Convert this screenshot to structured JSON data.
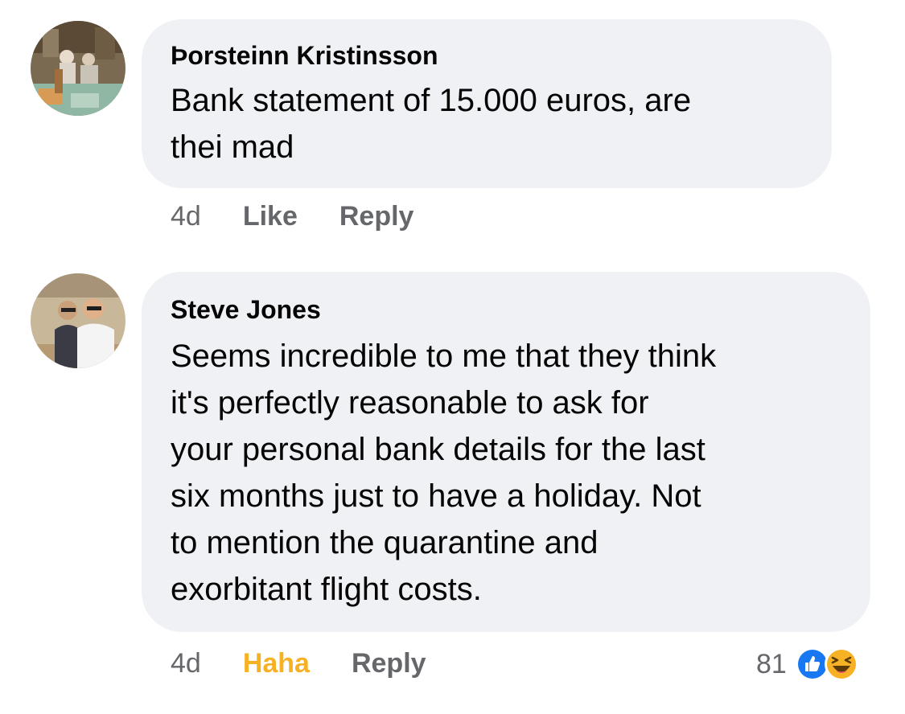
{
  "comments": [
    {
      "author": "Þorsteinn Kristinsson",
      "text": "Bank statement of 15.000 euros, are thei mad",
      "lines": [
        "Bank statement of 15.000 euros, are",
        "thei mad"
      ],
      "time": "4d",
      "like_label": "Like",
      "reply_label": "Reply"
    },
    {
      "author": "Steve Jones",
      "text": "Seems incredible to me that they think it's perfectly reasonable to ask for your personal bank details for the last six months just to have a holiday. Not to mention the quarantine and exorbitant flight costs.",
      "lines": [
        "Seems incredible to me that they think",
        "it's perfectly reasonable to ask for",
        "your personal bank details for the last",
        "six months just to have a holiday. Not",
        "to mention the quarantine and",
        "exorbitant flight costs."
      ],
      "time": "4d",
      "reaction_label": "Haha",
      "reply_label": "Reply",
      "reaction_count": "81",
      "reaction_icons": [
        "like-icon",
        "haha-icon"
      ]
    }
  ],
  "colors": {
    "bubble": "#f0f1f5",
    "text": "#050505",
    "secondary": "#65676b",
    "haha_active": "#f7b125",
    "like_blue": "#1877f2"
  }
}
